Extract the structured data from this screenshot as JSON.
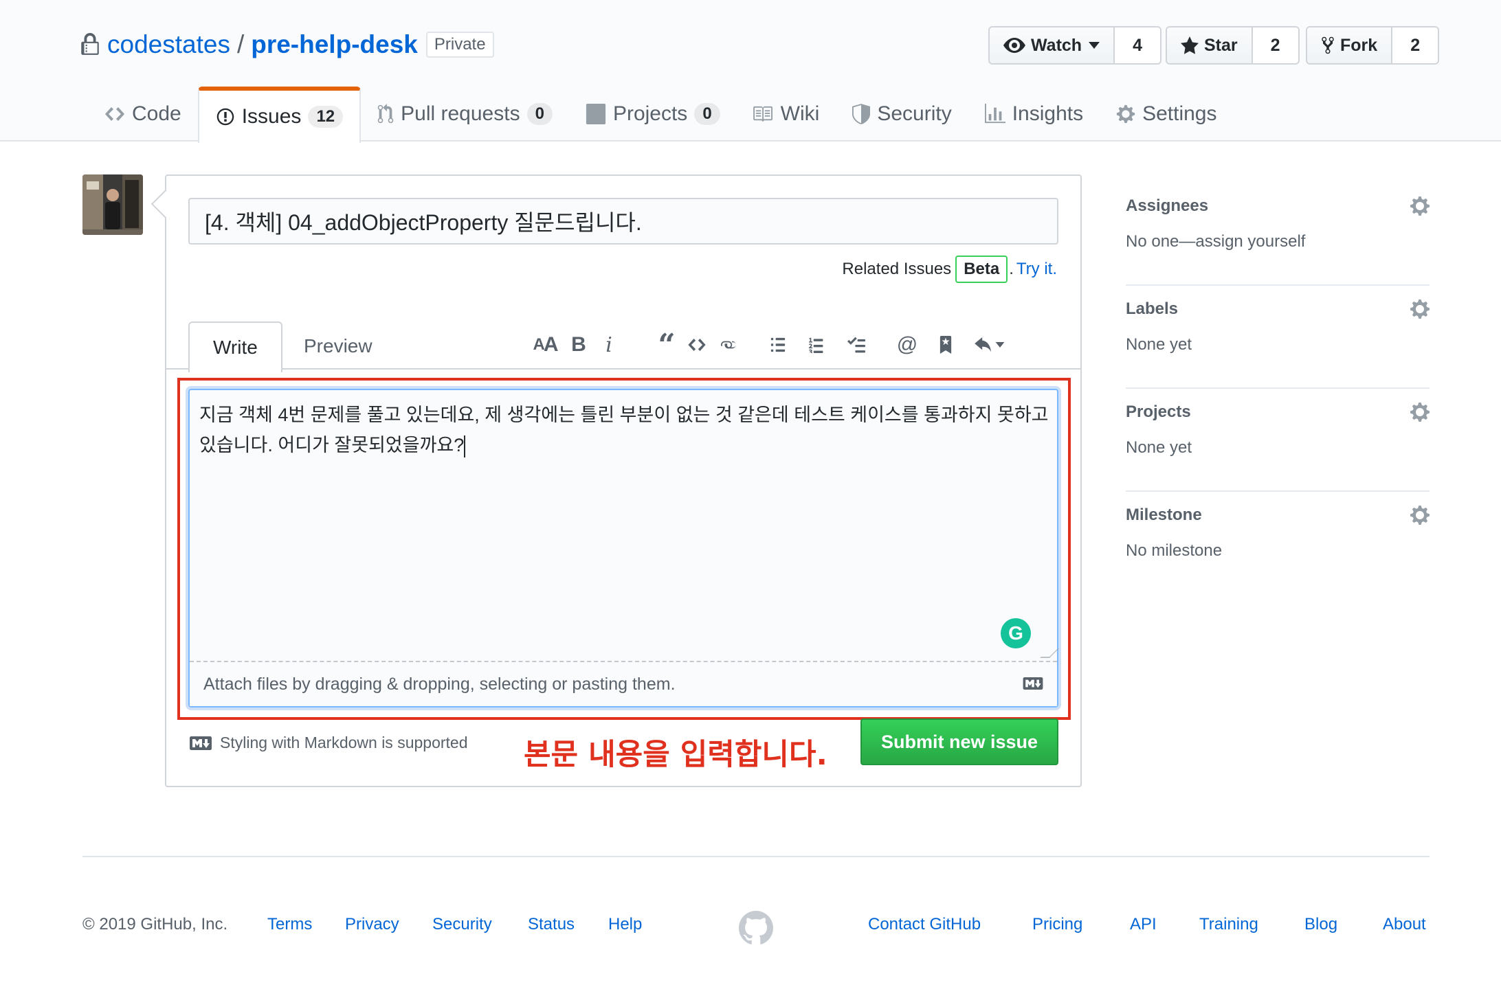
{
  "repo": {
    "owner": "codestates",
    "separator": "/",
    "name": "pre-help-desk",
    "visibility": "Private"
  },
  "actions": {
    "watch": {
      "label": "Watch",
      "count": "4"
    },
    "star": {
      "label": "Star",
      "count": "2"
    },
    "fork": {
      "label": "Fork",
      "count": "2"
    }
  },
  "nav": {
    "code": "Code",
    "issues": {
      "label": "Issues",
      "count": "12"
    },
    "pulls": {
      "label": "Pull requests",
      "count": "0"
    },
    "projects": {
      "label": "Projects",
      "count": "0"
    },
    "wiki": "Wiki",
    "security": "Security",
    "insights": "Insights",
    "settings": "Settings"
  },
  "issue_form": {
    "title_value": "[4. 객체] 04_addObjectProperty 질문드립니다.",
    "related_label": "Related Issues",
    "beta_label": "Beta",
    "try_link": "Try it.",
    "tabs": {
      "write": "Write",
      "preview": "Preview"
    },
    "body_line1": "지금 객체 4번 문제를 풀고 있는데요, 제 생각에는 틀린 부분이 없는 것 같은데 테스트 케이스를 통과하지 못하고",
    "body_line2": "있습니다. 어디가 잘못되었을까요?",
    "attach_text": "Attach files by dragging & dropping, selecting or pasting them.",
    "markdown_note": "Styling with Markdown is supported",
    "submit_label": "Submit new issue",
    "grammarly_letter": "G"
  },
  "annotation": "본문 내용을 입력합니다.",
  "accent_color": "#e0301e",
  "sidebar": [
    {
      "heading": "Assignees",
      "value": "No one—assign yourself"
    },
    {
      "heading": "Labels",
      "value": "None yet"
    },
    {
      "heading": "Projects",
      "value": "None yet"
    },
    {
      "heading": "Milestone",
      "value": "No milestone"
    }
  ],
  "footer": {
    "copyright": "© 2019 GitHub, Inc.",
    "left_links": [
      "Terms",
      "Privacy",
      "Security",
      "Status",
      "Help"
    ],
    "right_links": [
      "Contact GitHub",
      "Pricing",
      "API",
      "Training",
      "Blog",
      "About"
    ]
  }
}
